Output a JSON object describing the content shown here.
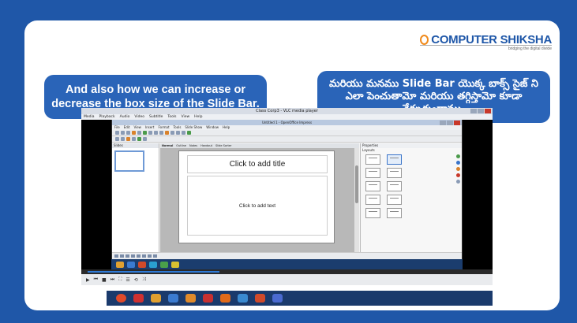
{
  "logo": {
    "name": "COMPUTER SHIKSHA",
    "tagline": "bridging the digital divide"
  },
  "captions": {
    "english": "And also how we can increase or decrease the box size of the Slide Bar.",
    "telugu": "మరియు మనము Slide Bar యొక్క బాక్స్ సైజ్ ని ఎలా పెంచుతామో మరియు తగ్గిస్తామో కూడా నేర్చుకుందాము."
  },
  "video": {
    "window_title": "Class Corp3 - VLC media player",
    "menu": [
      "Media",
      "Playback",
      "Audio",
      "Video",
      "Subtitle",
      "Tools",
      "View",
      "Help"
    ],
    "impress": {
      "window_title": "Untitled 1 - OpenOffice Impress",
      "menu": [
        "File",
        "Edit",
        "View",
        "Insert",
        "Format",
        "Tools",
        "Slide Show",
        "Window",
        "Help"
      ],
      "slides_pane_label": "Slides",
      "view_tabs": [
        "Normal",
        "Outline",
        "Notes",
        "Handout",
        "Slide Sorter"
      ],
      "properties_label": "Properties",
      "layouts_label": "Layouts",
      "slide": {
        "title_placeholder": "Click to add title",
        "text_placeholder": "Click to add text"
      }
    }
  },
  "colors": {
    "background": "#1f57a8",
    "caption_bubble": "#2a64b8",
    "logo_accent": "#f08a1c"
  }
}
